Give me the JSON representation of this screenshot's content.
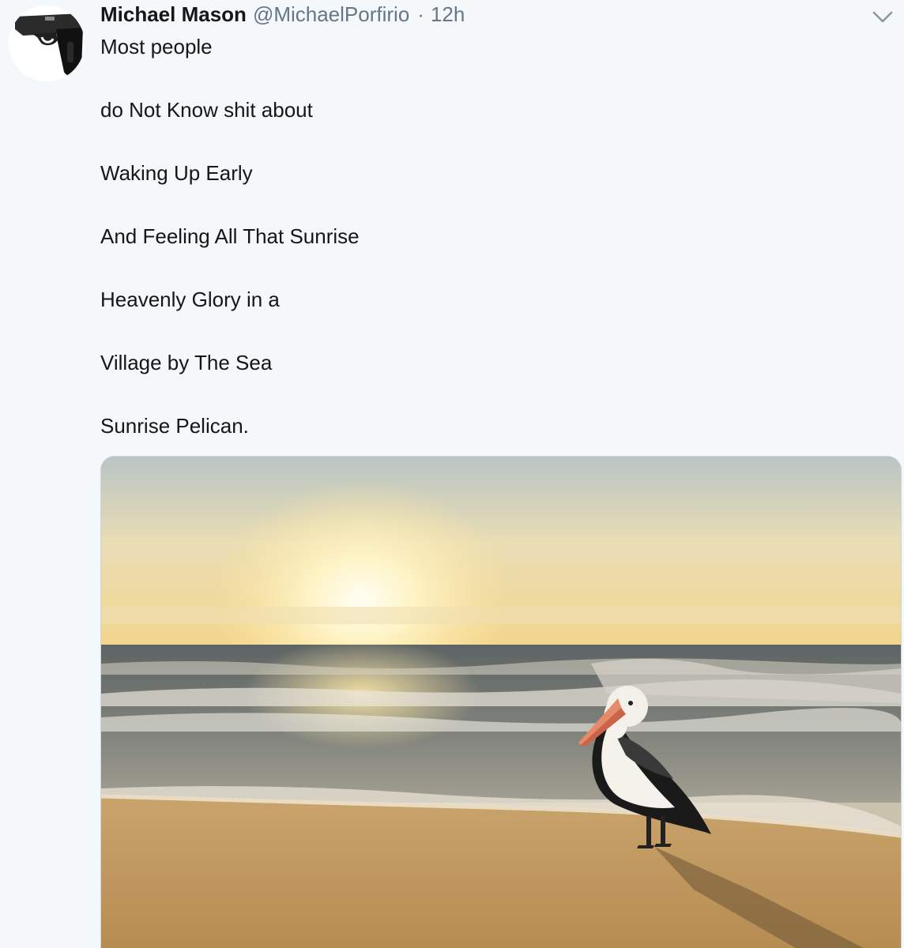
{
  "tweet": {
    "author": {
      "name": "Michael Mason",
      "handle": "@MichaelPorfirio",
      "avatar_icon": "pistol-icon"
    },
    "separator": "·",
    "time": "12h",
    "menu_icon": "chevron-down-icon",
    "lines": [
      "Most people",
      "do Not Know shit about",
      "Waking Up Early",
      "And Feeling All That Sunrise",
      "Heavenly Glory in a",
      "Village by The Sea",
      "Sunrise Pelican."
    ],
    "media": {
      "description_icon": "beach-sunrise-pelican-photo"
    }
  },
  "colors": {
    "background": "#f5f8fa",
    "text": "#14171a",
    "muted": "#657786"
  }
}
